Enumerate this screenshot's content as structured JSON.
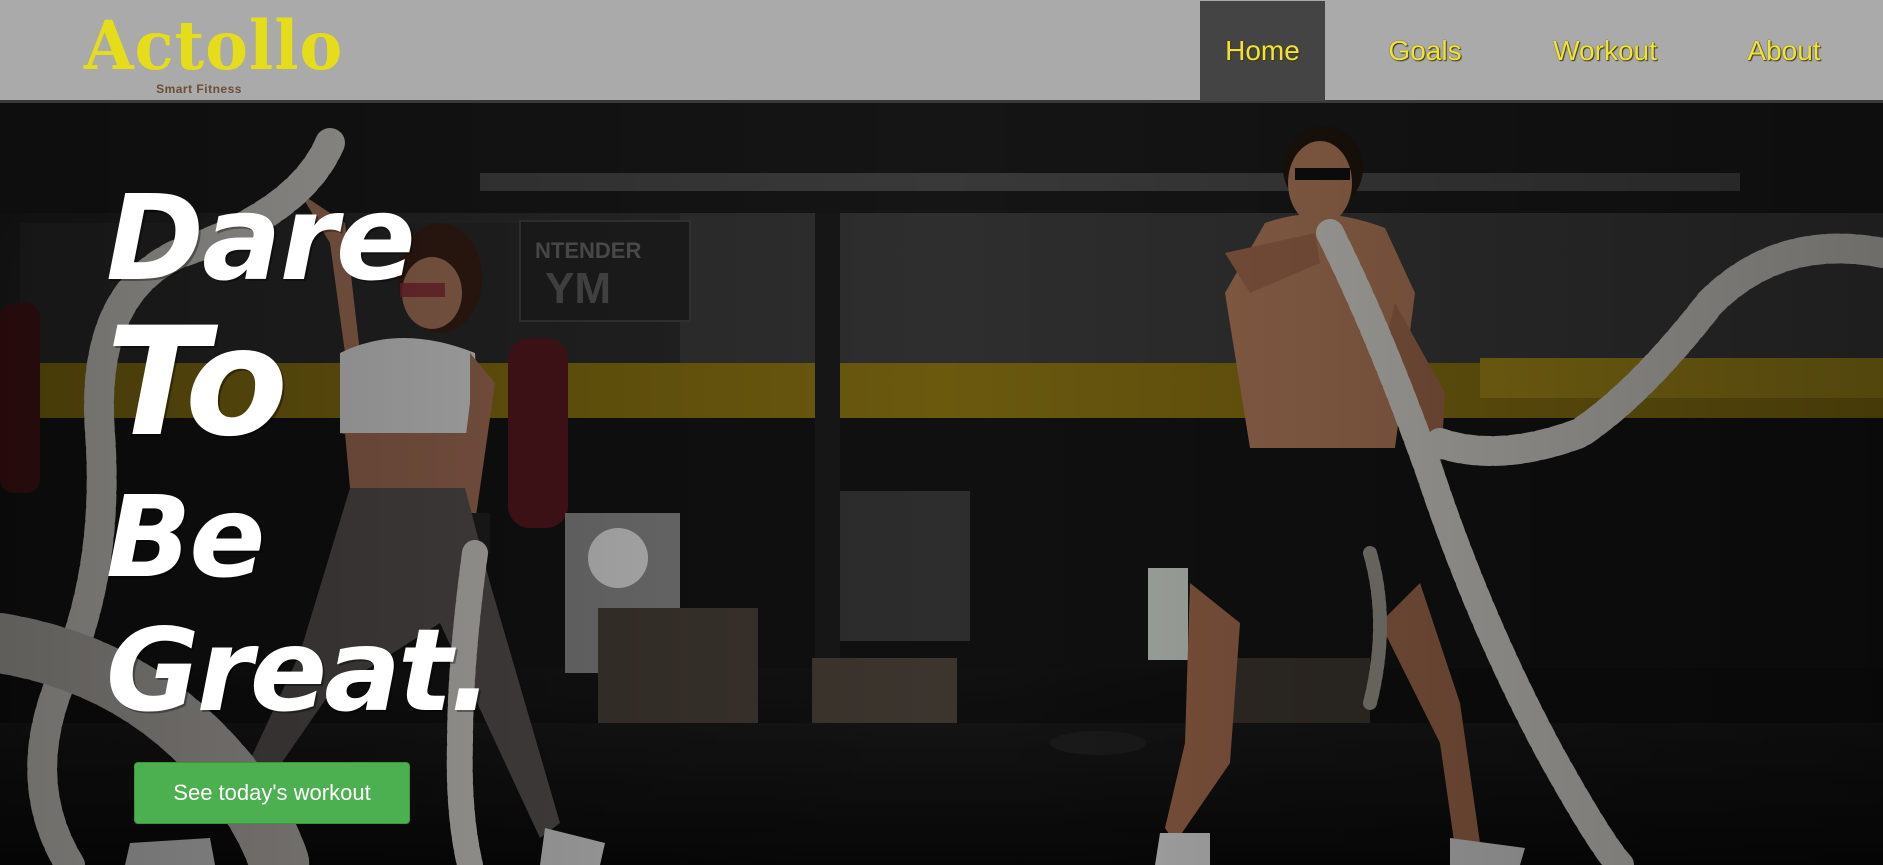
{
  "brand": {
    "name": "Actollo",
    "tagline": "Smart Fitness",
    "color": "#e6dd1a"
  },
  "nav": {
    "items": [
      {
        "label": "Home",
        "active": true
      },
      {
        "label": "Goals",
        "active": false
      },
      {
        "label": "Workout",
        "active": false
      },
      {
        "label": "About",
        "active": false
      }
    ],
    "text_color": "#f1e23a",
    "active_bg": "#444444",
    "bar_bg": "#aaaaaa"
  },
  "hero": {
    "headline_lines": [
      "Dare",
      "To",
      "Be",
      "Great."
    ],
    "cta_label": "See today's workout",
    "cta_color": "#4caf50",
    "background_image": "gym-battle-ropes-photo"
  }
}
